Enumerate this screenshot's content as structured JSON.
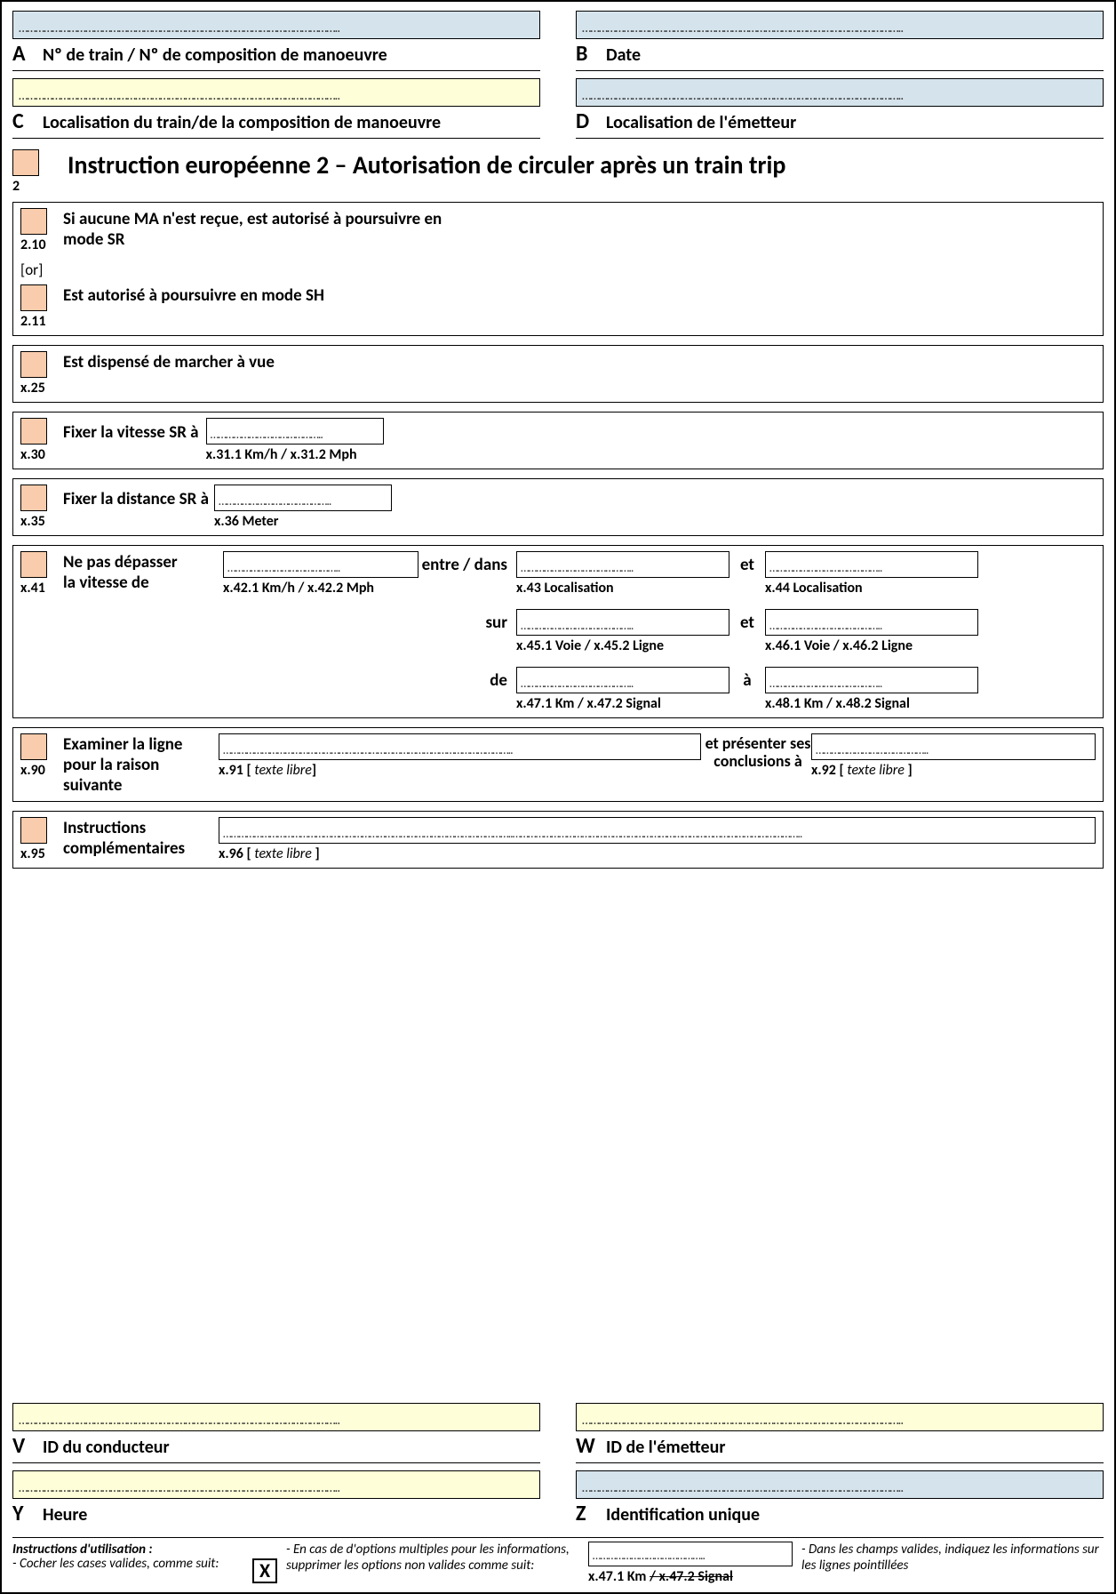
{
  "header": {
    "A": {
      "letter": "A",
      "label": "Nº de train / Nº de composition de manoeuvre"
    },
    "B": {
      "letter": "B",
      "label": "Date"
    },
    "C": {
      "letter": "C",
      "label": "Localisation du train/de la composition de manoeuvre"
    },
    "D": {
      "letter": "D",
      "label": "Localisation de l'émetteur"
    }
  },
  "title": {
    "num": "2",
    "text": "Instruction européenne 2 – Autorisation de circuler après un train trip"
  },
  "sec_2_10": {
    "num": "2.10",
    "label": "Si aucune MA n'est reçue, est autorisé à poursuivre en mode SR"
  },
  "or_label": "[or]",
  "sec_2_11": {
    "num": "2.11",
    "label": "Est autorisé à poursuivre en mode SH"
  },
  "sec_x25": {
    "num": "x.25",
    "label": "Est dispensé de marcher à vue"
  },
  "sec_x30": {
    "num": "x.30",
    "label": "Fixer la vitesse SR à",
    "caption": "x.31.1  Km/h / x.31.2  Mph"
  },
  "sec_x35": {
    "num": "x.35",
    "label": "Fixer la distance SR à",
    "caption": "x.36  Meter"
  },
  "sec_x41": {
    "num": "x.41",
    "label_line1": "Ne pas dépasser",
    "label_line2": "la vitesse de",
    "f42": "x.42.1  Km/h / x.42.2  Mph",
    "entre": "entre / dans",
    "f43": "x.43  Localisation",
    "et": "et",
    "f44": "x.44  Localisation",
    "sur": "sur",
    "f45": "x.45.1  Voie / x.45.2  Ligne",
    "f46": "x.46.1  Voie / x.46.2  Ligne",
    "de": "de",
    "f47": "x.47.1  Km / x.47.2  Signal",
    "a": "à",
    "f48": "x.48.1  Km / x.48.2  Signal"
  },
  "sec_x90": {
    "num": "x.90",
    "label": "Examiner la ligne pour la raison suivante",
    "f91_pre": "x.91 [",
    "f91_it": " texte libre",
    "f91_post": "]",
    "mid": "et présenter ses conclusions à",
    "f92_pre": "x.92 [",
    "f92_it": " texte libre ",
    "f92_post": "]"
  },
  "sec_x95": {
    "num": "x.95",
    "label": "Instructions complémentaires",
    "f96_pre": "x.96 [",
    "f96_it": " texte libre ",
    "f96_post": "]"
  },
  "footer": {
    "V": {
      "letter": "V",
      "label": "ID du conducteur"
    },
    "W": {
      "letter": "W",
      "label": "ID de l'émetteur"
    },
    "Y": {
      "letter": "Y",
      "label": "Heure"
    },
    "Z": {
      "letter": "Z",
      "label": "Identification unique"
    }
  },
  "instructions": {
    "title": "Instructions d'utilisation :",
    "i1": "- Cocher les cases valides, comme suit:",
    "x": "X",
    "i2": "- En cas de d'options multiples pour les informations, supprimer les options non valides comme suit:",
    "ex_a": "x.47.1  Km ",
    "ex_slash": "/ ",
    "ex_b": "x.47.2  Signal",
    "i3": "- Dans les champs valides, indiquez les informations sur les lignes pointillées"
  }
}
